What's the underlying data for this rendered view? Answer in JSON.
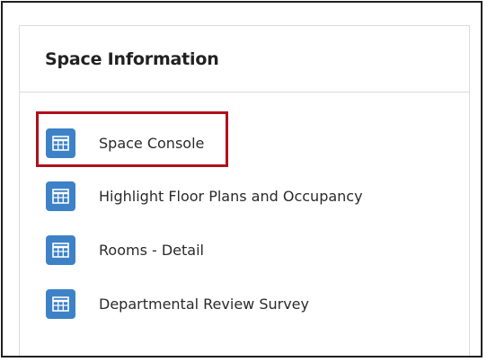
{
  "panel": {
    "title": "Space Information",
    "items": [
      {
        "label": "Space Console",
        "icon": "table-grid-icon",
        "highlighted": true
      },
      {
        "label": "Highlight Floor Plans and Occupancy",
        "icon": "table-grid-icon"
      },
      {
        "label": "Rooms - Detail",
        "icon": "table-grid-icon"
      },
      {
        "label": "Departmental Review Survey",
        "icon": "table-grid-icon"
      }
    ]
  },
  "colors": {
    "icon_background": "#3d82c7",
    "highlight_border": "#b0101a"
  }
}
